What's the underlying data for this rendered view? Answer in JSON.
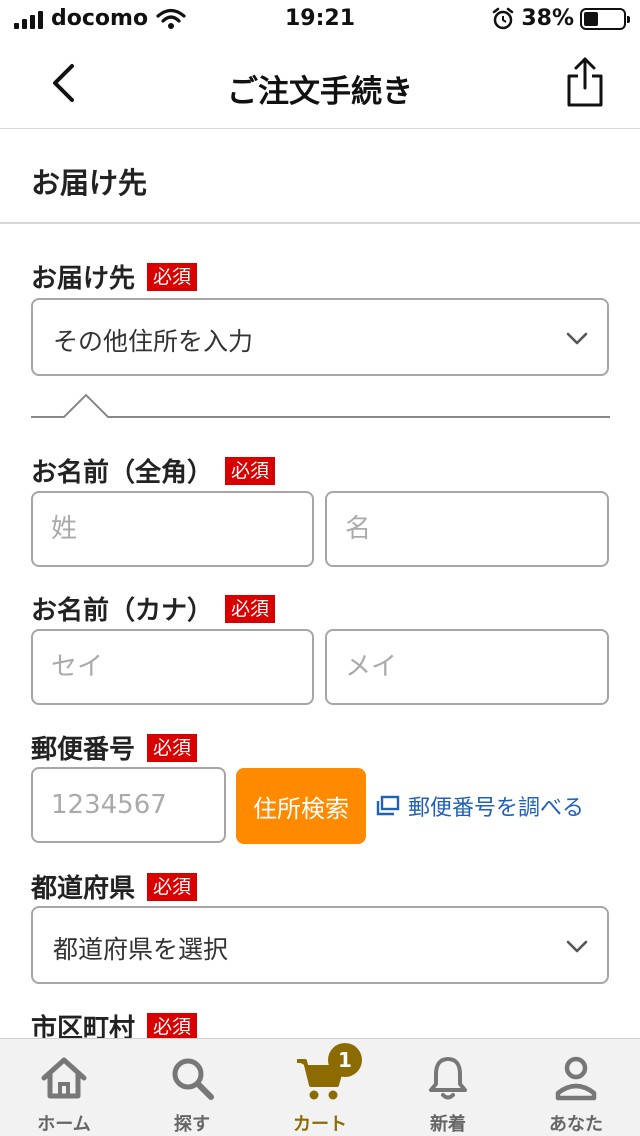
{
  "status_bar": {
    "carrier": "docomo",
    "time": "19:21",
    "battery_percent": "38%",
    "battery_level": 0.38
  },
  "nav": {
    "title": "ご注文手続き",
    "back_icon": "chevron-left-icon",
    "share_icon": "share-icon"
  },
  "section": {
    "title": "お届け先"
  },
  "form": {
    "required_badge": "必須",
    "destination": {
      "label": "お届け先",
      "selected": "その他住所を入力"
    },
    "name_kanji": {
      "label": "お名前（全角）",
      "last_placeholder": "姓",
      "first_placeholder": "名"
    },
    "name_kana": {
      "label": "お名前（カナ）",
      "last_placeholder": "セイ",
      "first_placeholder": "メイ"
    },
    "postal": {
      "label": "郵便番号",
      "placeholder": "1234567",
      "search_button": "住所検索",
      "lookup_link": "郵便番号を調べる"
    },
    "prefecture": {
      "label": "都道府県",
      "selected": "都道府県を選択"
    },
    "city": {
      "label": "市区町村"
    }
  },
  "tab_bar": {
    "items": [
      {
        "label": "ホーム",
        "icon": "home-icon"
      },
      {
        "label": "探す",
        "icon": "search-icon"
      },
      {
        "label": "カート",
        "icon": "cart-icon",
        "badge": "1",
        "active": true
      },
      {
        "label": "新着",
        "icon": "bell-icon"
      },
      {
        "label": "あなた",
        "icon": "person-icon"
      }
    ]
  },
  "colors": {
    "required": "#d90000",
    "search_button": "#ff8a00",
    "link": "#1f60b8",
    "active_tab": "#8c6b00"
  }
}
